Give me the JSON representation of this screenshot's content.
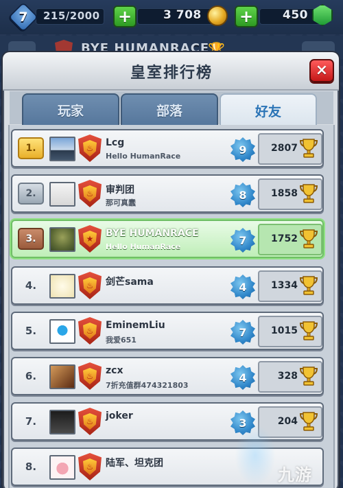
{
  "topbar": {
    "level": "7",
    "xp": "215/2000",
    "gold": "3 708",
    "gems": "450"
  },
  "profile": {
    "name": "BYE HUMANRACE"
  },
  "panel": {
    "title": "皇室排行榜",
    "close_label": "×"
  },
  "tabs": [
    {
      "label": "玩家",
      "active": false
    },
    {
      "label": "部落",
      "active": false
    },
    {
      "label": "好友",
      "active": true
    }
  ],
  "rows": [
    {
      "rank": "1.",
      "rank_style": "gold",
      "name": "Lcg",
      "clan": "Hello HumanRace",
      "level": "9",
      "trophies": "2807"
    },
    {
      "rank": "2.",
      "rank_style": "silver",
      "name": "审判团",
      "clan": "那可真蠢",
      "level": "8",
      "trophies": "1858"
    },
    {
      "rank": "3.",
      "rank_style": "bronze",
      "name": "BYE HUMANRACE",
      "clan": "Hello HumanRace",
      "level": "7",
      "trophies": "1752",
      "highlight": true
    },
    {
      "rank": "4.",
      "rank_style": "plain",
      "name": "剑芒sama",
      "clan": "",
      "level": "4",
      "trophies": "1334"
    },
    {
      "rank": "5.",
      "rank_style": "plain",
      "name": "EminemLiu",
      "clan": "我爱651",
      "level": "7",
      "trophies": "1015"
    },
    {
      "rank": "6.",
      "rank_style": "plain",
      "name": "zcx",
      "clan": "7折充值群474321803",
      "level": "4",
      "trophies": "328"
    },
    {
      "rank": "7.",
      "rank_style": "plain",
      "name": "joker",
      "clan": "",
      "level": "3",
      "trophies": "204"
    },
    {
      "rank": "8.",
      "rank_style": "plain",
      "name": "陆军、坦克团",
      "clan": "",
      "level": "",
      "trophies": ""
    }
  ],
  "watermark": "九游",
  "colors": {
    "highlight_row": "#bfeeb8",
    "close_button": "#d92a2a",
    "level_badge": "#2f86c9",
    "trophy_gold": "#e9b02a"
  }
}
